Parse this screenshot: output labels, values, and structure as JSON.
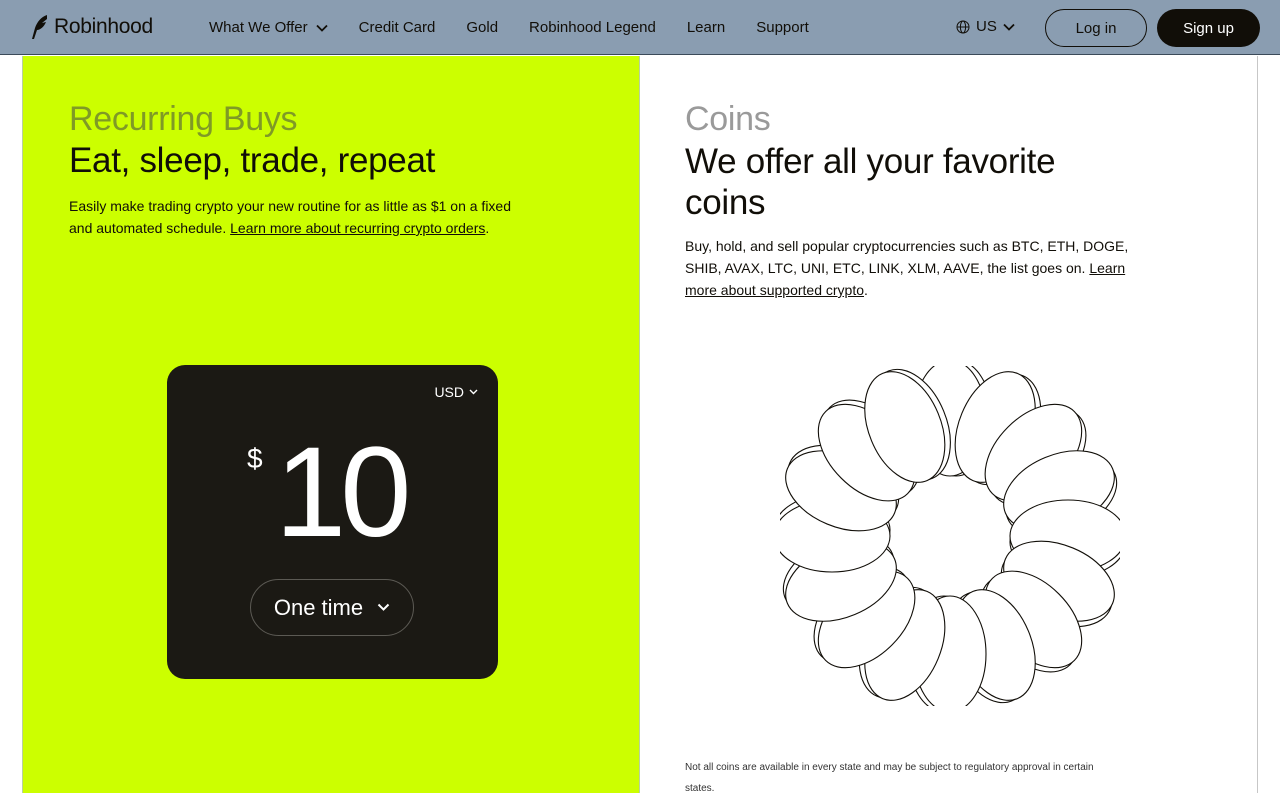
{
  "header": {
    "brand": "Robinhood",
    "nav": [
      {
        "label": "What We Offer",
        "has_dropdown": true
      },
      {
        "label": "Credit Card"
      },
      {
        "label": "Gold"
      },
      {
        "label": "Robinhood Legend"
      },
      {
        "label": "Learn"
      },
      {
        "label": "Support"
      }
    ],
    "region": "US",
    "login_label": "Log in",
    "signup_label": "Sign up",
    "colors": {
      "bar": "#8a9db1",
      "signup_bg": "#110e08"
    }
  },
  "recurring": {
    "eyebrow": "Recurring Buys",
    "headline": "Eat, sleep, trade, repeat",
    "body": "Easily make trading crypto your new routine for as little as $1 on a fixed and automated schedule. ",
    "link": "Learn more about recurring crypto orders",
    "link_suffix": ".",
    "card": {
      "currency": "USD",
      "currency_symbol": "$",
      "amount": "10",
      "frequency": "One time"
    },
    "colors": {
      "panel": "#ccff00",
      "card": "#1b1914"
    }
  },
  "coins": {
    "eyebrow": "Coins",
    "headline": "We offer all your favorite coins",
    "body": "Buy, hold, and sell popular cryptocurrencies such as BTC, ETH, DOGE, SHIB, AVAX, LTC, UNI, ETC, LINK, XLM, AAVE, the list goes on. ",
    "link": "Learn more about supported crypto",
    "link_suffix": ".",
    "disclaimer": "Not all coins are available in every state and may be subject to regulatory approval in certain states."
  }
}
